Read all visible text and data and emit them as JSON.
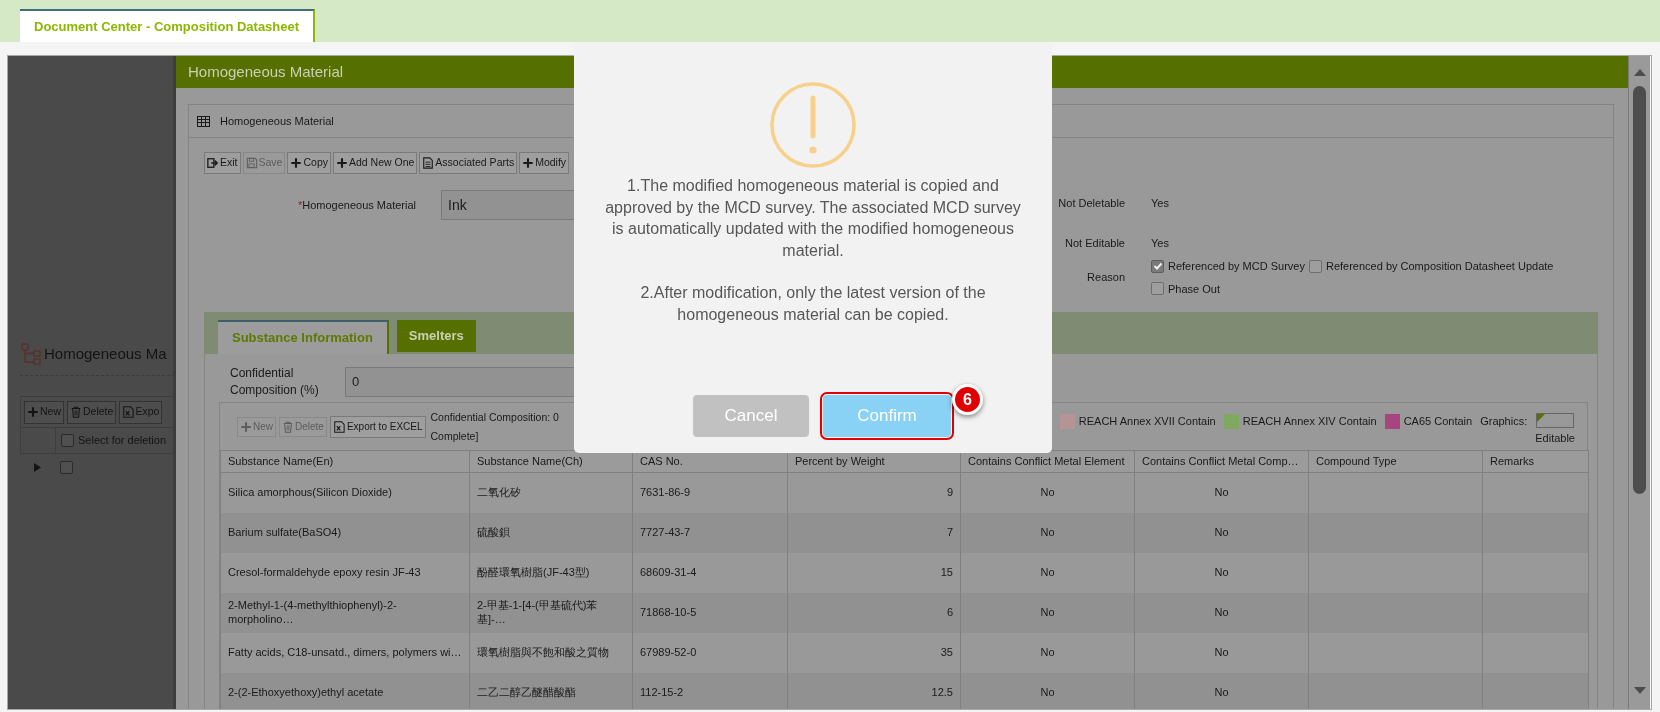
{
  "top_tab": {
    "label": "Document Center - Composition Datasheet",
    "selected": true
  },
  "background_page": {
    "title": "Homogeneous Ma",
    "toolbar": [
      {
        "label": "New",
        "kind": "plus"
      },
      {
        "label": "Delete",
        "kind": "trash"
      },
      {
        "label": "Expo",
        "kind": "excel"
      }
    ],
    "select_header": "Select for deletion",
    "select_all_checked": false,
    "rows": [
      {
        "checked": false
      }
    ]
  },
  "window": {
    "title": "Homogeneous Material",
    "panel_title": "Homogeneous Material",
    "toolbar": [
      {
        "label": "Exit",
        "kind": "exit",
        "disabled": false
      },
      {
        "label": "Save",
        "kind": "save",
        "disabled": true
      },
      {
        "label": "Copy",
        "kind": "plus",
        "disabled": false
      },
      {
        "label": "Add New One",
        "kind": "plus",
        "disabled": false
      },
      {
        "label": "Associated Parts",
        "kind": "document",
        "disabled": false
      },
      {
        "label": "Modify",
        "kind": "plus",
        "disabled": false
      }
    ],
    "material_field": {
      "required_mark": "*",
      "label": "Homogeneous Material",
      "value": "Ink"
    },
    "properties": [
      {
        "label": "Not Deletable",
        "value": "Yes"
      },
      {
        "label": "Not Editable",
        "value": "Yes"
      }
    ],
    "reason": {
      "label": "Reason",
      "options": [
        {
          "label": "Referenced by MCD Survey",
          "checked": true
        },
        {
          "label": "Referenced by Composition Datasheet Update",
          "checked": false
        },
        {
          "label": "Phase Out",
          "checked": false
        }
      ]
    },
    "tabs": [
      {
        "label": "Substance Information",
        "selected": true
      },
      {
        "label": "Smelters",
        "selected": false
      }
    ],
    "confidential_field": {
      "label": "Confidential Composition (%)",
      "value": "0"
    },
    "grid_toolbar": [
      {
        "label": "New",
        "kind": "plus",
        "disabled": true
      },
      {
        "label": "Delete",
        "kind": "trash",
        "disabled": true
      },
      {
        "label": "Export to EXCEL",
        "kind": "excel",
        "disabled": false
      }
    ],
    "grid_note": [
      "Confidential Composition: 0",
      "Complete]"
    ],
    "legend": [
      {
        "label": "REACH Annex XVII Contain",
        "color": "#b49494"
      },
      {
        "label": "REACH Annex XIV Contain",
        "color": "#7fa860"
      },
      {
        "label": "CA65 Contain",
        "color": "#a8447f"
      }
    ],
    "graphics": {
      "label": "Graphics:",
      "caption": "Editable"
    },
    "table": {
      "columns": [
        "Substance Name(En)",
        "Substance Name(Ch)",
        "CAS No.",
        "Percent by Weight",
        "Contains Conflict Metal Element",
        "Contains Conflict Metal Comp…",
        "Compound Type",
        "Remarks"
      ],
      "rows": [
        [
          "Silica amorphous(Silicon Dioxide)",
          "二氧化矽",
          "7631-86-9",
          "9",
          "No",
          "No"
        ],
        [
          "Barium sulfate(BaSO4)",
          "硫酸鋇",
          "7727-43-7",
          "7",
          "No",
          "No"
        ],
        [
          "Cresol-formaldehyde epoxy resin JF-43",
          "酚醛環氧樹脂(JF-43型)",
          "68609-31-4",
          "15",
          "No",
          "No"
        ],
        [
          "2-Methyl-1-(4-methylthiophenyl)-2-morpholino…",
          "2-甲基-1-[4-(甲基硫代)苯基]-…",
          "71868-10-5",
          "6",
          "No",
          "No"
        ],
        [
          "Fatty acids, C18-unsatd., dimers, polymers wi…",
          "環氧樹脂與不飽和酸之質物",
          "67989-52-0",
          "35",
          "No",
          "No"
        ],
        [
          "2-(2-Ethoxyethoxy)ethyl acetate",
          "二乙二醇乙醚醋酸酯",
          "112-15-2",
          "12.5",
          "No",
          "No"
        ]
      ]
    }
  },
  "dialog": {
    "paragraphs": [
      "1.The modified homogeneous material is copied and approved by the MCD survey. The associated MCD survey is automatically updated with the modified homogeneous material.",
      "2.After modification, only the latest version of the homogeneous material can be copied."
    ],
    "buttons": [
      {
        "label": "Cancel",
        "kind": "cancel",
        "highlighted": false
      },
      {
        "label": "Confirm",
        "kind": "confirm",
        "highlighted": true
      }
    ]
  },
  "step_badge": "6"
}
